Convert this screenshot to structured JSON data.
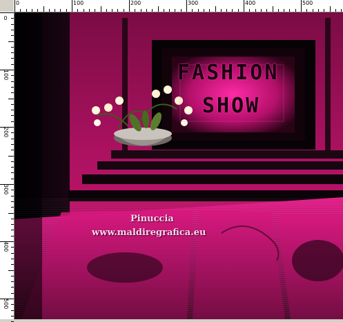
{
  "ruler": {
    "top_labels": [
      "0",
      "100",
      "200",
      "300",
      "400",
      "500"
    ],
    "left_labels": [
      "0",
      "100",
      "200",
      "300",
      "400",
      "500"
    ]
  },
  "scene": {
    "logo_line1": "FASHION",
    "logo_line2": "SHOW",
    "watermark_name": "Pinuccia",
    "watermark_url": "www.maldiregrafica.eu"
  },
  "colors": {
    "magenta": "#c4126e",
    "dark_magenta": "#5a0a33",
    "hot_pink": "#ff1a9c",
    "black": "#0a0408",
    "ruler_bg": "#ffffff"
  }
}
